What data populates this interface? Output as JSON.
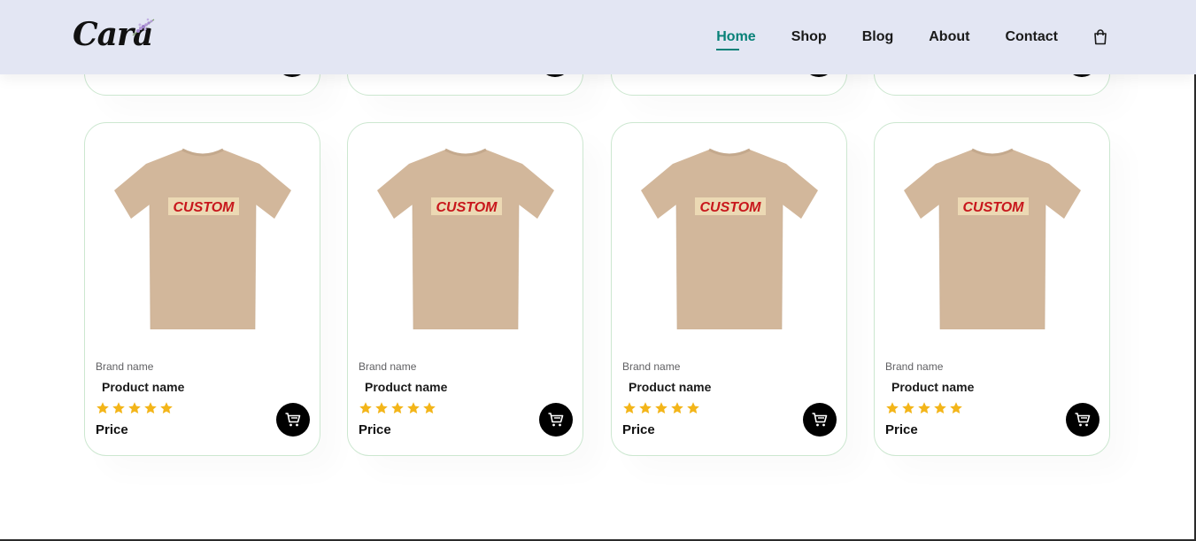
{
  "header": {
    "logo_text": "Cara",
    "nav": [
      {
        "label": "Home",
        "active": true
      },
      {
        "label": "Shop",
        "active": false
      },
      {
        "label": "Blog",
        "active": false
      },
      {
        "label": "About",
        "active": false
      },
      {
        "label": "Contact",
        "active": false
      }
    ],
    "cart_icon": "shopping-bag-icon"
  },
  "colors": {
    "header_bg": "#e3e6f3",
    "accent": "#088178",
    "star": "#f3b519",
    "card_border": "#cce7d0",
    "shirt": "#d2b79b",
    "custom_text": "#c8171c"
  },
  "products": [
    {
      "image_text": "CUSTOM",
      "brand": "Brand name",
      "name": "Product name",
      "rating": 5,
      "price": "Price"
    },
    {
      "image_text": "CUSTOM",
      "brand": "Brand name",
      "name": "Product name",
      "rating": 5,
      "price": "Price"
    },
    {
      "image_text": "CUSTOM",
      "brand": "Brand name",
      "name": "Product name",
      "rating": 5,
      "price": "Price"
    },
    {
      "image_text": "CUSTOM",
      "brand": "Brand name",
      "name": "Product name",
      "rating": 5,
      "price": "Price"
    }
  ]
}
